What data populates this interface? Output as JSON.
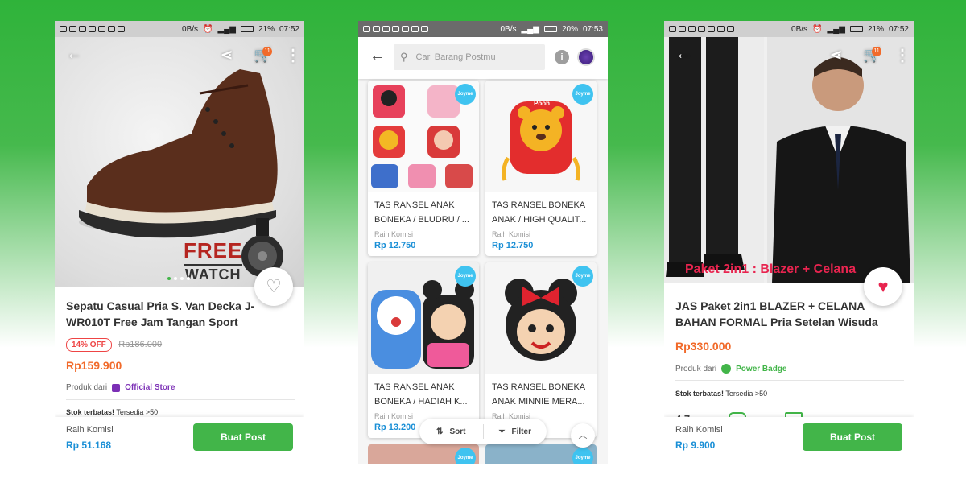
{
  "colors": {
    "accent": "#42b549",
    "price": "#f16a2a",
    "commission": "#1a8fd6",
    "official_store": "#7b2fb5"
  },
  "phone1": {
    "status": {
      "left_icons": 7,
      "speed": "0B/s",
      "battery": "21%",
      "time": "07:52"
    },
    "cart_count": "11",
    "product": {
      "title": "Sepatu Casual Pria S. Van Decka J-WR010T Free Jam Tangan Sport",
      "discount": "14% OFF",
      "old_price": "Rp186.000",
      "price": "Rp159.900",
      "seller_prefix": "Produk dari",
      "seller_badge": "Official Store",
      "stock_label": "Stok terbatas!",
      "stock_value": "Tersedia >50",
      "promo_line1": "FREE",
      "promo_line2": "WATCH"
    },
    "bottom": {
      "commission_label": "Raih Komisi",
      "commission_value": "Rp 51.168",
      "button": "Buat Post"
    }
  },
  "phone2": {
    "status": {
      "speed": "0B/s",
      "battery": "20%",
      "time": "07:53"
    },
    "search": {
      "placeholder": "Cari Barang Postmu"
    },
    "info_icon": "i",
    "badge": "Joyme",
    "products": [
      {
        "title": "TAS RANSEL ANAK BONEKA / BLUDRU / ...",
        "sub": "Raih Komisi",
        "price": "Rp 12.750"
      },
      {
        "title": "TAS RANSEL BONEKA ANAK / HIGH QUALIT...",
        "sub": "Raih Komisi",
        "price": "Rp 12.750"
      },
      {
        "title": "TAS RANSEL ANAK BONEKA / HADIAH K...",
        "sub": "Raih Komisi",
        "price": "Rp 13.200"
      },
      {
        "title": "TAS RANSEL BONEKA ANAK MINNIE MERA...",
        "sub": "Raih Komisi",
        "price": ""
      }
    ],
    "sort_label": "Sort",
    "filter_label": "Filter",
    "first_image_label": "Pooh"
  },
  "phone3": {
    "status": {
      "speed": "0B/s",
      "battery": "21%",
      "time": "07:52"
    },
    "cart_count": "11",
    "image_caption": "Paket 2in1 : Blazer + Celana",
    "product": {
      "title": "JAS Paket 2in1 BLAZER + CELANA BAHAN FORMAL Pria Setelan Wisuda",
      "price": "Rp330.000",
      "seller_prefix": "Produk dari",
      "seller_badge": "Power Badge",
      "stock_label": "Stok terbatas!",
      "stock_value": "Tersedia >50",
      "rating": "4.7"
    },
    "bottom": {
      "commission_label": "Raih Komisi",
      "commission_value": "Rp 9.900",
      "button": "Buat Post"
    }
  }
}
